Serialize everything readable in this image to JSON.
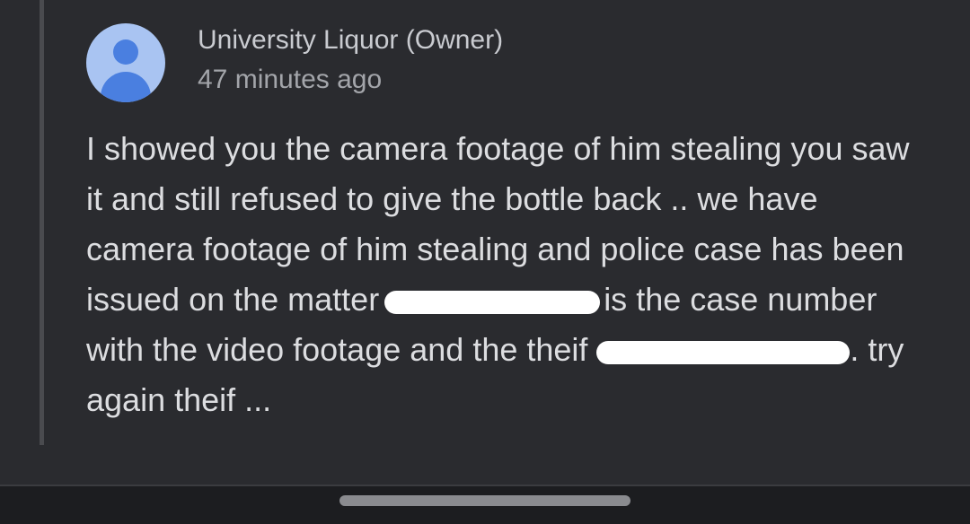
{
  "comment": {
    "author": "University Liquor (Owner)",
    "timestamp": "47 minutes ago",
    "avatar_icon": "person-icon",
    "text_part1": "I showed you the camera footage of him stealing you saw it and still refused to give the bottle back .. we have camera footage of him stealing and police case has been issued on the matter",
    "text_part2": "is the case number with the video footage and the theif",
    "text_part3": ". try again theif ..."
  },
  "colors": {
    "background": "#2a2b2f",
    "avatar_bg": "#a9c4f2",
    "avatar_fg": "#4a7fe0",
    "redaction": "#ffffff"
  }
}
